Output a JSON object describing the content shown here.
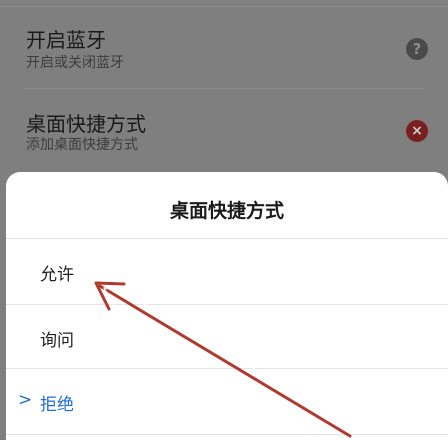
{
  "settings": {
    "bluetooth": {
      "title": "开启蓝牙",
      "subtitle": "开启或关闭蓝牙",
      "help_icon": "question-circle-icon"
    },
    "shortcut": {
      "title": "桌面快捷方式",
      "subtitle": "添加桌面快捷方式",
      "status_icon": "close-circle-icon"
    }
  },
  "dialog": {
    "title": "桌面快捷方式",
    "options": [
      {
        "label": "允许",
        "selected": false
      },
      {
        "label": "询问",
        "selected": false
      },
      {
        "label": "拒绝",
        "selected": true
      }
    ],
    "selected_marker": ">"
  },
  "colors": {
    "overlay": "#7f7f7f",
    "accent": "#1f6fd8",
    "annotation_arrow": "#c0392b"
  }
}
